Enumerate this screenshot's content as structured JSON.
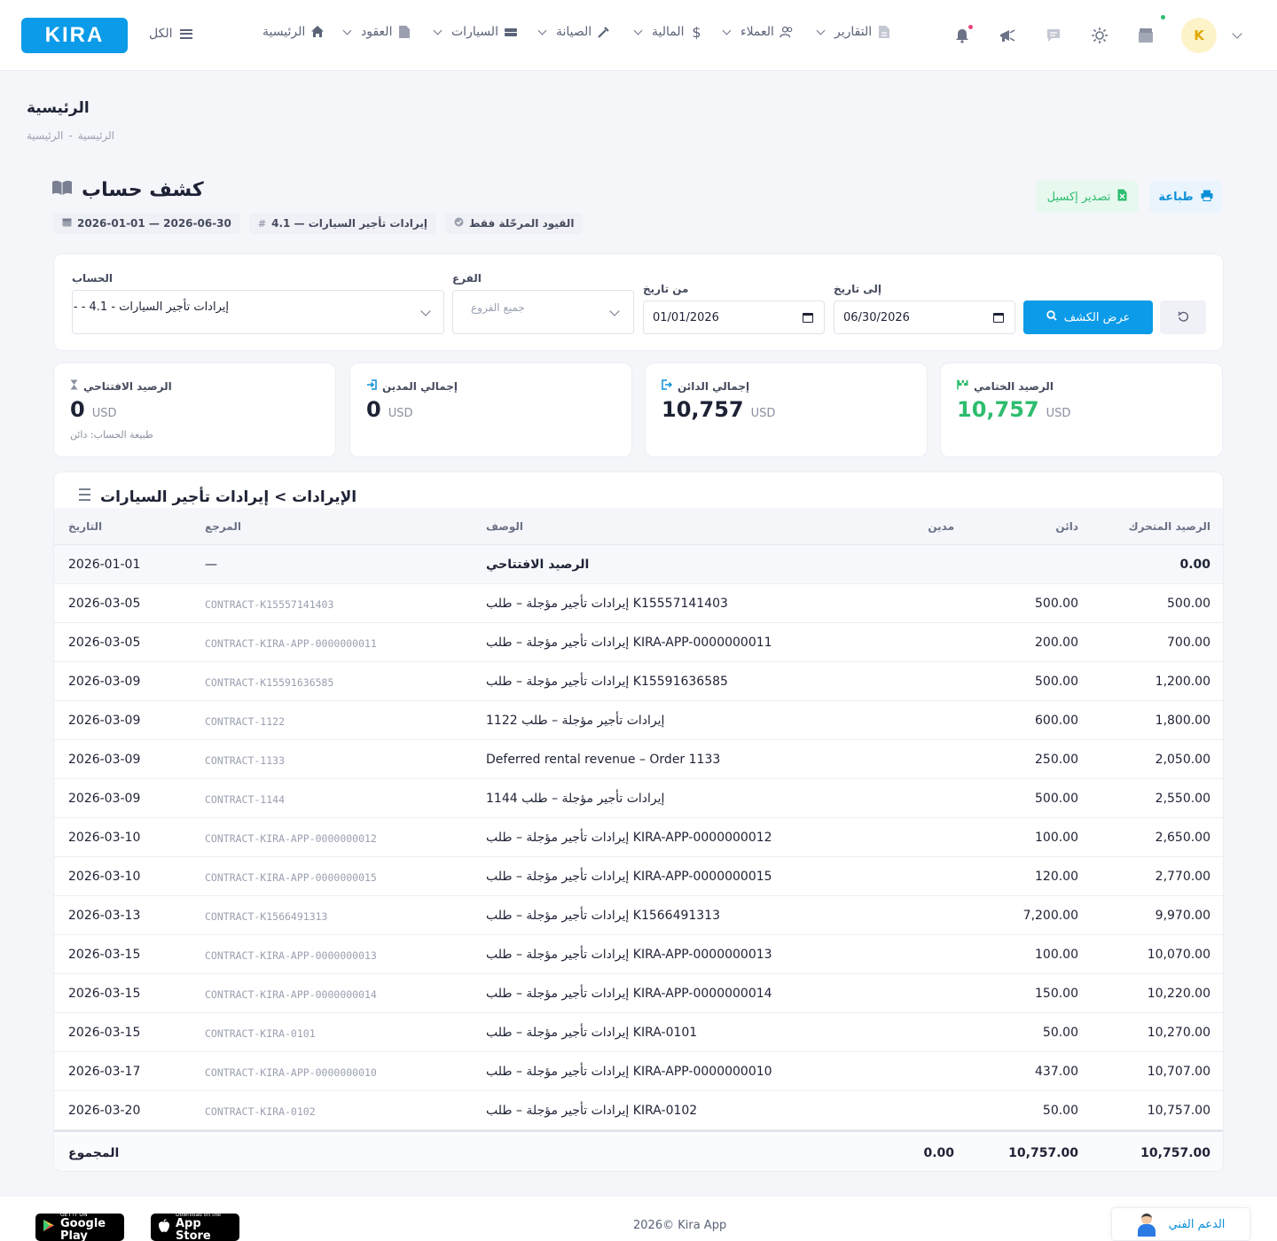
{
  "nav": {
    "logo": "KIRA",
    "all_label": "الكل",
    "items": [
      {
        "label": "الرئيسية",
        "icon": "home-icon"
      },
      {
        "label": "العقود",
        "icon": "document-icon"
      },
      {
        "label": "السيارات",
        "icon": "car-icon"
      },
      {
        "label": "الصيانة",
        "icon": "wrench-icon"
      },
      {
        "label": "المالية",
        "icon": "dollar-icon"
      },
      {
        "label": "العملاء",
        "icon": "users-icon"
      },
      {
        "label": "التقارير",
        "icon": "report-icon"
      }
    ],
    "avatar_initial": "K",
    "accent_color": "#0b9be8"
  },
  "page": {
    "title": "الرئيسية",
    "breadcrumb": [
      "الرئيسية",
      "-",
      "الرئيسية"
    ]
  },
  "statement": {
    "title": "كشف حساب",
    "chips": {
      "posted_only": "القيود المرحّلة فقط",
      "account": "إيرادات تأجير السيارات — 4.1",
      "range": "2026-01-01 — 2026-06-30"
    },
    "print_label": "طباعة",
    "export_label": "تصدير إكسيل"
  },
  "filters": {
    "account_label": "الحساب",
    "account_value": "إيرادات تأجير السيارات - 4.1 - -",
    "branch_label": "الفرع",
    "branch_placeholder": "جميع الفروع",
    "from_label": "من تاريخ",
    "from_value": "01/01/2026",
    "to_label": "إلى تاريخ",
    "to_value": "06/30/2026",
    "show_label": "عرض الكشف"
  },
  "stats": {
    "opening": {
      "label": "الرصيد الافتتاحي",
      "value": "0",
      "currency": "USD",
      "note": "طبيعة الحساب: دائن"
    },
    "debit": {
      "label": "إجمالي المدين",
      "value": "0",
      "currency": "USD"
    },
    "credit": {
      "label": "إجمالي الدائن",
      "value": "10,757",
      "currency": "USD"
    },
    "closing": {
      "label": "الرصيد الختامي",
      "value": "10,757",
      "currency": "USD",
      "color": "#2dbd6e"
    }
  },
  "table": {
    "title": "الإيرادات > إيرادات تأجير السيارات",
    "headers": {
      "date": "التاريخ",
      "ref": "المرجع",
      "desc": "الوصف",
      "debit": "مدين",
      "credit": "دائن",
      "balance": "الرصيد المتحرك"
    },
    "opening_row": {
      "date": "2026-01-01",
      "ref": "—",
      "desc": "الرصيد الافتتاحي",
      "debit": "",
      "credit": "",
      "balance": "0.00"
    },
    "rows": [
      {
        "date": "2026-03-05",
        "ref": "CONTRACT-K15557141403",
        "desc": "إيرادات تأجير مؤجلة – طلب K15557141403",
        "debit": "",
        "credit": "500.00",
        "balance": "500.00"
      },
      {
        "date": "2026-03-05",
        "ref": "CONTRACT-KIRA-APP-0000000011",
        "desc": "إيرادات تأجير مؤجلة – طلب KIRA-APP-0000000011",
        "debit": "",
        "credit": "200.00",
        "balance": "700.00"
      },
      {
        "date": "2026-03-09",
        "ref": "CONTRACT-K15591636585",
        "desc": "إيرادات تأجير مؤجلة – طلب K15591636585",
        "debit": "",
        "credit": "500.00",
        "balance": "1,200.00"
      },
      {
        "date": "2026-03-09",
        "ref": "CONTRACT-1122",
        "desc": "إيرادات تأجير مؤجلة – طلب 1122",
        "debit": "",
        "credit": "600.00",
        "balance": "1,800.00"
      },
      {
        "date": "2026-03-09",
        "ref": "CONTRACT-1133",
        "desc": "Deferred rental revenue – Order 1133",
        "debit": "",
        "credit": "250.00",
        "balance": "2,050.00"
      },
      {
        "date": "2026-03-09",
        "ref": "CONTRACT-1144",
        "desc": "إيرادات تأجير مؤجلة – طلب 1144",
        "debit": "",
        "credit": "500.00",
        "balance": "2,550.00"
      },
      {
        "date": "2026-03-10",
        "ref": "CONTRACT-KIRA-APP-0000000012",
        "desc": "إيرادات تأجير مؤجلة – طلب KIRA-APP-0000000012",
        "debit": "",
        "credit": "100.00",
        "balance": "2,650.00"
      },
      {
        "date": "2026-03-10",
        "ref": "CONTRACT-KIRA-APP-0000000015",
        "desc": "إيرادات تأجير مؤجلة – طلب KIRA-APP-0000000015",
        "debit": "",
        "credit": "120.00",
        "balance": "2,770.00"
      },
      {
        "date": "2026-03-13",
        "ref": "CONTRACT-K1566491313",
        "desc": "إيرادات تأجير مؤجلة – طلب K1566491313",
        "debit": "",
        "credit": "7,200.00",
        "balance": "9,970.00"
      },
      {
        "date": "2026-03-15",
        "ref": "CONTRACT-KIRA-APP-0000000013",
        "desc": "إيرادات تأجير مؤجلة – طلب KIRA-APP-0000000013",
        "debit": "",
        "credit": "100.00",
        "balance": "10,070.00"
      },
      {
        "date": "2026-03-15",
        "ref": "CONTRACT-KIRA-APP-0000000014",
        "desc": "إيرادات تأجير مؤجلة – طلب KIRA-APP-0000000014",
        "debit": "",
        "credit": "150.00",
        "balance": "10,220.00"
      },
      {
        "date": "2026-03-15",
        "ref": "CONTRACT-KIRA-0101",
        "desc": "إيرادات تأجير مؤجلة – طلب KIRA-0101",
        "debit": "",
        "credit": "50.00",
        "balance": "10,270.00"
      },
      {
        "date": "2026-03-17",
        "ref": "CONTRACT-KIRA-APP-0000000010",
        "desc": "إيرادات تأجير مؤجلة – طلب KIRA-APP-0000000010",
        "debit": "",
        "credit": "437.00",
        "balance": "10,707.00"
      },
      {
        "date": "2026-03-20",
        "ref": "CONTRACT-KIRA-0102",
        "desc": "إيرادات تأجير مؤجلة – طلب KIRA-0102",
        "debit": "",
        "credit": "50.00",
        "balance": "10,757.00"
      }
    ],
    "totals": {
      "label": "المجموع",
      "debit": "0.00",
      "credit": "10,757.00",
      "balance": "10,757.00"
    }
  },
  "footer": {
    "google_small": "GET IT ON",
    "google_big": "Google Play",
    "apple_small": "Download on the",
    "apple_big": "App Store",
    "copyright": "2026© Kira App",
    "support": "الدعم الفني"
  }
}
